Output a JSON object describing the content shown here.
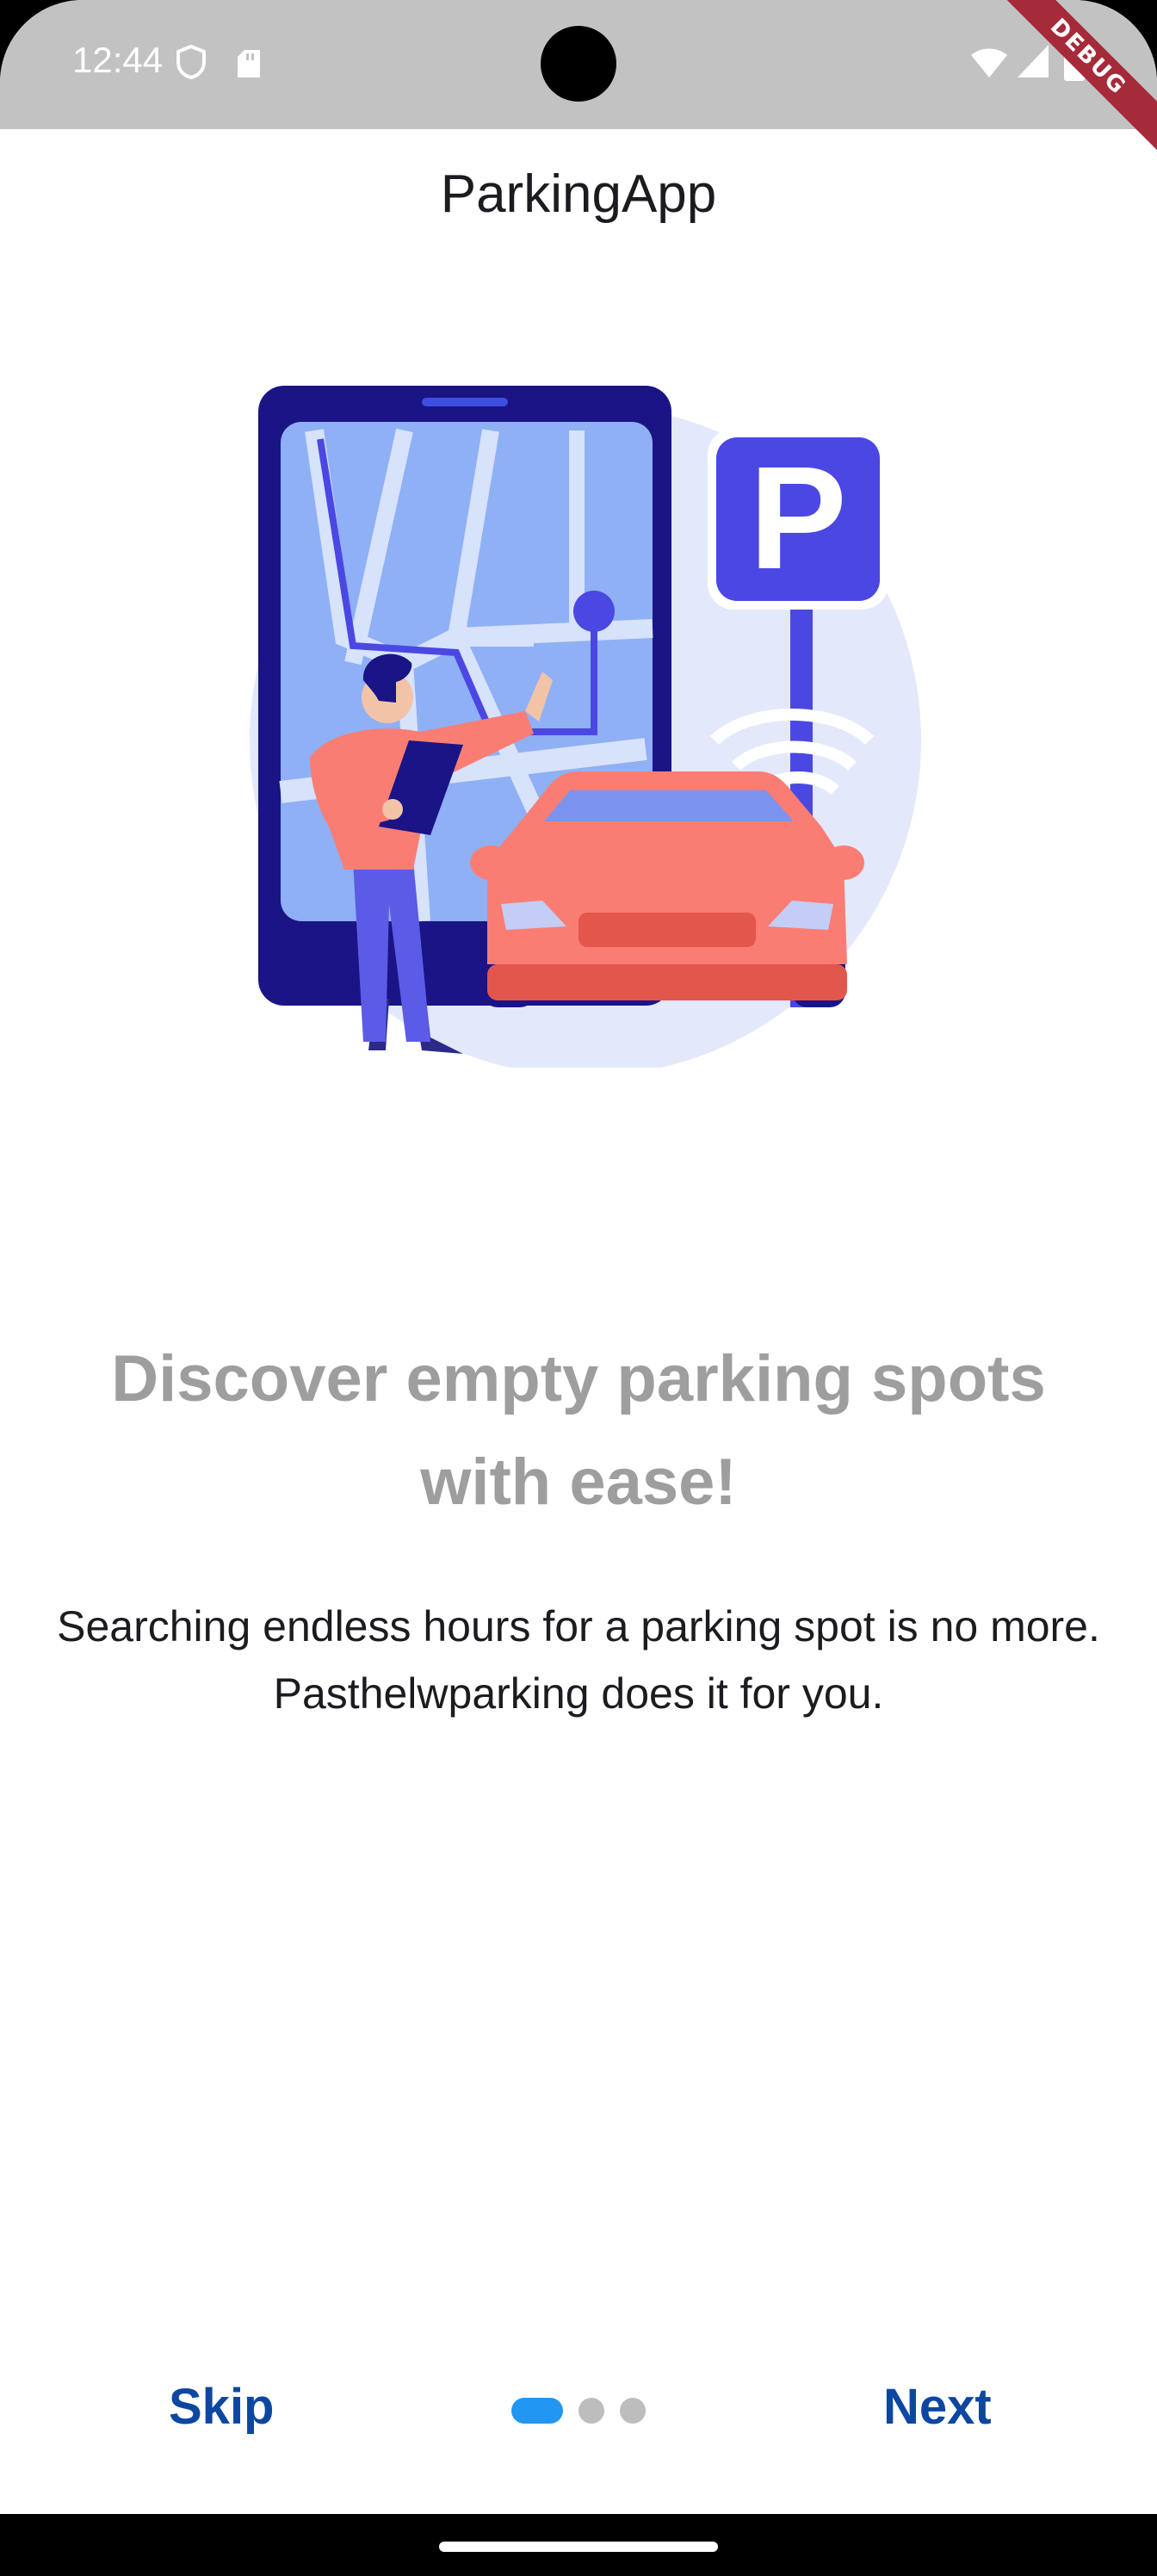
{
  "status_bar": {
    "time": "12:44",
    "icons": [
      "shield-icon",
      "sd-card-icon",
      "wifi-icon",
      "signal-icon",
      "battery-icon"
    ],
    "debug_label": "DEBUG"
  },
  "app_bar": {
    "title": "ParkingApp"
  },
  "onboarding": {
    "illustration": {
      "sign_letter": "P"
    },
    "headline": "Discover empty parking spots with ease!",
    "body": "Searching endless hours for a parking spot is no more. Pasthelwparking does it for you.",
    "page_count": 3,
    "current_page": 1
  },
  "controls": {
    "skip_label": "Skip",
    "next_label": "Next"
  },
  "colors": {
    "accent": "#2196f3",
    "button_text": "#0d47a1",
    "headline": "#9e9e9e",
    "dot_inactive": "#bdbdbd"
  }
}
